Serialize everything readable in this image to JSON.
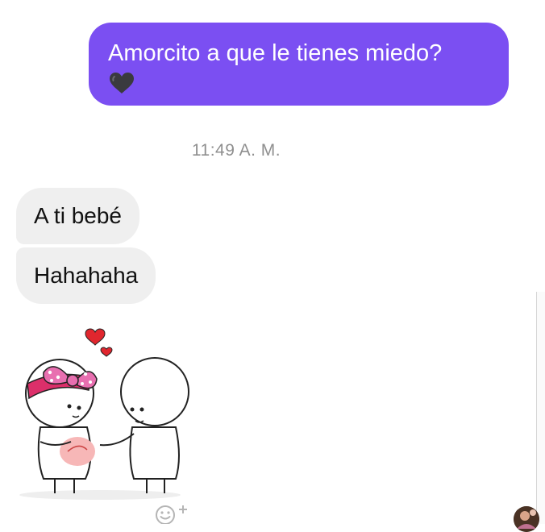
{
  "messages": {
    "outgoing": {
      "text": "Amorcito a que le tienes miedo?",
      "emoji": "black-heart-icon"
    },
    "timestamp": "11:49 A. M.",
    "incoming": [
      {
        "text": "A ti bebé"
      },
      {
        "text": "Hahahaha"
      }
    ],
    "sticker": "couple-pregnancy-sticker"
  },
  "actions": {
    "react": "add-reaction-icon"
  },
  "colors": {
    "outgoing_bubble": "#7b4ff2",
    "incoming_bubble": "#efefef",
    "timestamp_text": "#8f8f8f"
  }
}
